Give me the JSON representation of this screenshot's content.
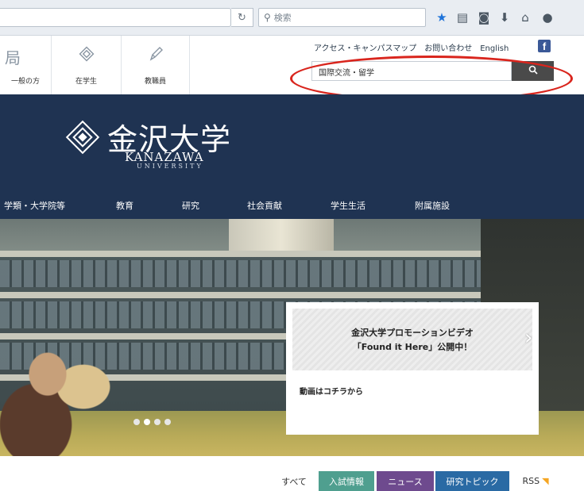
{
  "browser": {
    "search_placeholder": "検索",
    "search_icon": "magnifier-icon",
    "reload_icon": "reload-icon",
    "toolbar_icons": [
      "bookmark-star-icon",
      "reading-list-icon",
      "pocket-icon",
      "download-icon",
      "home-icon",
      "chat-icon"
    ],
    "star_color": "#1e73d9"
  },
  "header": {
    "nav": [
      {
        "icon": "building-icon",
        "label": "一般の方"
      },
      {
        "icon": "diamond-icon",
        "label": "在学生"
      },
      {
        "icon": "pen-icon",
        "label": "教職員"
      }
    ],
    "nav_partial_glyph": "局",
    "utility_links": "アクセス・キャンパスマップ　お問い合わせ　English",
    "search_value": "国際交流・留学",
    "search_button_icon": "search-icon",
    "annotation_color": "#d9251d"
  },
  "banner": {
    "logo_jp": "金沢大学",
    "logo_en": "KANAZAWA",
    "logo_en_sub": "UNIVERSITY",
    "bg_color": "#1f3352",
    "global_nav": [
      "学類・大学院等",
      "教育",
      "研究",
      "社会貢献",
      "学生生活",
      "附属施設"
    ]
  },
  "hero": {
    "promo_title": "金沢大学プロモーションビデオ",
    "promo_sub": "「Found it Here」公開中！",
    "promo_link": "動画はコチラから",
    "next_icon": "chevron-right-icon",
    "slide_count": 4
  },
  "news_tabs": [
    {
      "label": "すべて",
      "bg": "#ffffff",
      "fg": "#333333"
    },
    {
      "label": "入試情報",
      "bg": "#4f9f8f",
      "fg": "#ffffff"
    },
    {
      "label": "ニュース",
      "bg": "#6e4a8e",
      "fg": "#ffffff"
    },
    {
      "label": "研究トピック",
      "bg": "#2a6aa4",
      "fg": "#ffffff"
    }
  ],
  "rss_label": "RSS",
  "rss_color": "#f5a623"
}
